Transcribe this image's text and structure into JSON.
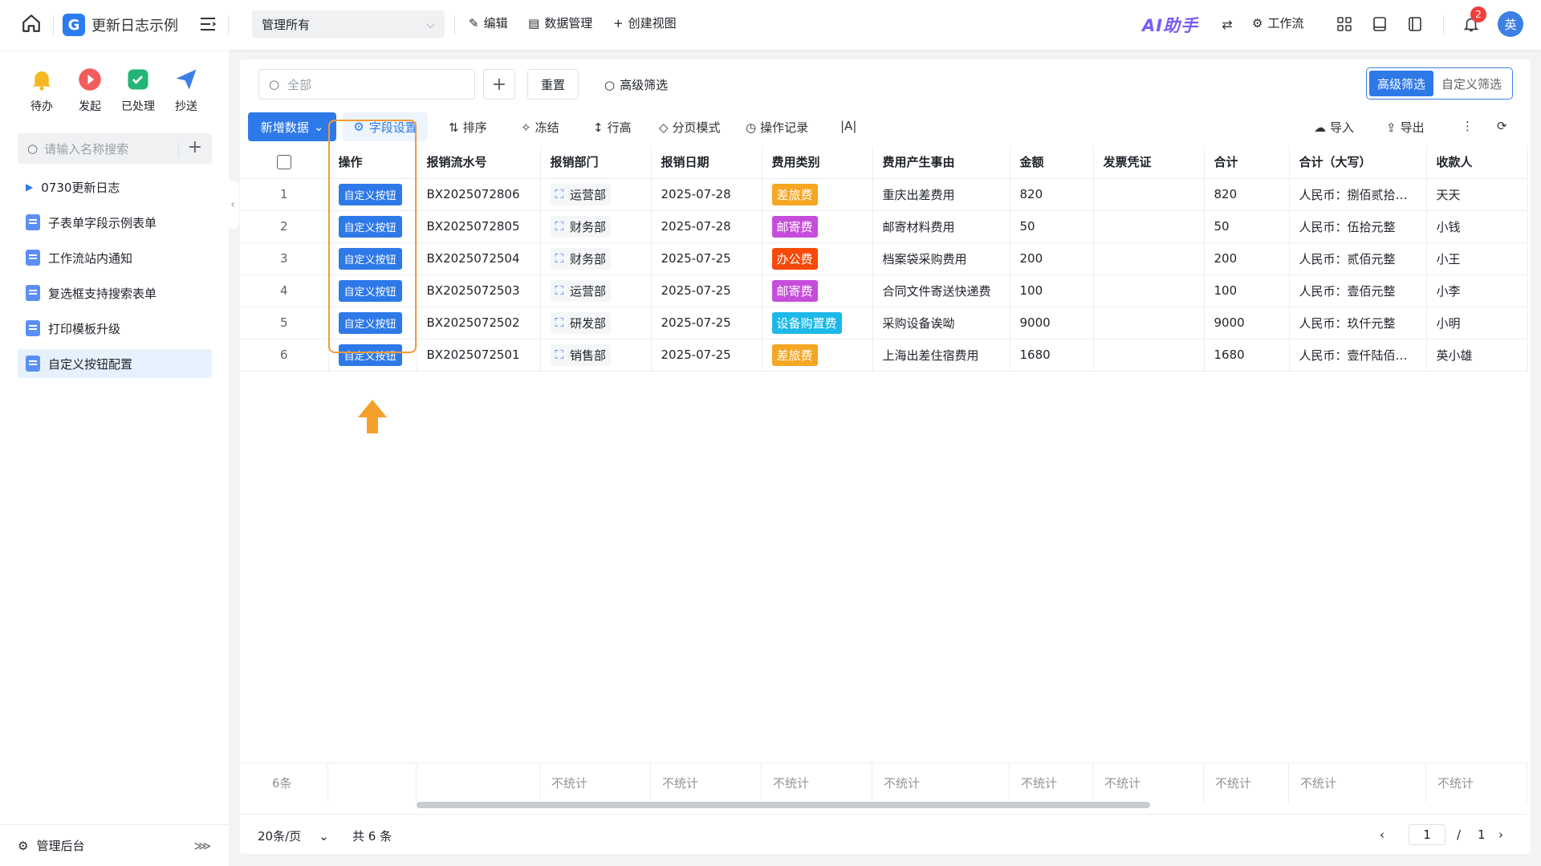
{
  "app": {
    "title": "更新日志示例"
  },
  "header": {
    "view_select": "管理所有",
    "edit": "编辑",
    "data_mgmt": "数据管理",
    "create_view": "创建视图",
    "ai_helper": "AI助手",
    "workflow": "工作流",
    "notif_count": "2",
    "avatar": "英"
  },
  "sidebar": {
    "quick": [
      {
        "label": "待办",
        "icon": "bell-icon",
        "color": "#f5b820"
      },
      {
        "label": "发起",
        "icon": "play-icon",
        "color": "#f25c5c"
      },
      {
        "label": "已处理",
        "icon": "check-icon",
        "color": "#22b573"
      },
      {
        "label": "抄送",
        "icon": "send-icon",
        "color": "#3d7fe6"
      }
    ],
    "search_placeholder": "请输入名称搜索",
    "group": "0730更新日志",
    "items": [
      "子表单字段示例表单",
      "工作流站内通知",
      "复选框支持搜索表单",
      "打印模板升级",
      "自定义按钮配置"
    ],
    "active_index": 4,
    "footer": "管理后台"
  },
  "filter": {
    "search_placeholder": "全部",
    "reset": "重置",
    "advanced": "高级筛选",
    "seg": [
      "高级筛选",
      "自定义筛选"
    ]
  },
  "toolbar": {
    "new": "新增数据",
    "fields": "字段设置",
    "sort": "排序",
    "freeze": "冻结",
    "row_height": "行高",
    "paging": "分页模式",
    "log": "操作记录",
    "fontsize": "|A|",
    "import": "导入",
    "export": "导出"
  },
  "table": {
    "headers": [
      "操作",
      "报销流水号",
      "报销部门",
      "报销日期",
      "费用类别",
      "费用产生事由",
      "金额",
      "发票凭证",
      "合计",
      "合计（大写）",
      "收款人"
    ],
    "button_label": "自定义按钮",
    "rows": [
      {
        "no": "1",
        "serial": "BX2025072806",
        "dept": "运营部",
        "date": "2025-07-28",
        "cat": "差旅费",
        "cat_color": "#f5a623",
        "reason": "重庆出差费用",
        "amount": "820",
        "invoice": "",
        "total": "820",
        "total_cn": "人民币：捌佰贰拾元整",
        "payee": "天天"
      },
      {
        "no": "2",
        "serial": "BX2025072805",
        "dept": "财务部",
        "date": "2025-07-28",
        "cat": "邮寄费",
        "cat_color": "#c64ddb",
        "reason": "邮寄材料费用",
        "amount": "50",
        "invoice": "",
        "total": "50",
        "total_cn": "人民币：伍拾元整",
        "payee": "小钱"
      },
      {
        "no": "3",
        "serial": "BX2025072504",
        "dept": "财务部",
        "date": "2025-07-25",
        "cat": "办公费",
        "cat_color": "#f54a0a",
        "reason": "档案袋采购费用",
        "amount": "200",
        "invoice": "",
        "total": "200",
        "total_cn": "人民币：贰佰元整",
        "payee": "小王"
      },
      {
        "no": "4",
        "serial": "BX2025072503",
        "dept": "运营部",
        "date": "2025-07-25",
        "cat": "邮寄费",
        "cat_color": "#c64ddb",
        "reason": "合同文件寄送快递费",
        "amount": "100",
        "invoice": "",
        "total": "100",
        "total_cn": "人民币：壹佰元整",
        "payee": "小李"
      },
      {
        "no": "5",
        "serial": "BX2025072502",
        "dept": "研发部",
        "date": "2025-07-25",
        "cat": "设备购置费",
        "cat_color": "#1cb9e8",
        "reason": "采购设备诶呦",
        "amount": "9000",
        "invoice": "",
        "total": "9000",
        "total_cn": "人民币：玖仟元整",
        "payee": "小明"
      },
      {
        "no": "6",
        "serial": "BX2025072501",
        "dept": "销售部",
        "date": "2025-07-25",
        "cat": "差旅费",
        "cat_color": "#f5a623",
        "reason": "上海出差住宿费用",
        "amount": "1680",
        "invoice": "",
        "total": "1680",
        "total_cn": "人民币：壹仟陆佰捌拾元整",
        "payee": "英小雄"
      }
    ],
    "count_label": "6条",
    "no_stat": "不统计"
  },
  "pager": {
    "per_page": "20条/页",
    "total": "共 6 条",
    "page": "1",
    "sep": "/",
    "pages": "1"
  }
}
